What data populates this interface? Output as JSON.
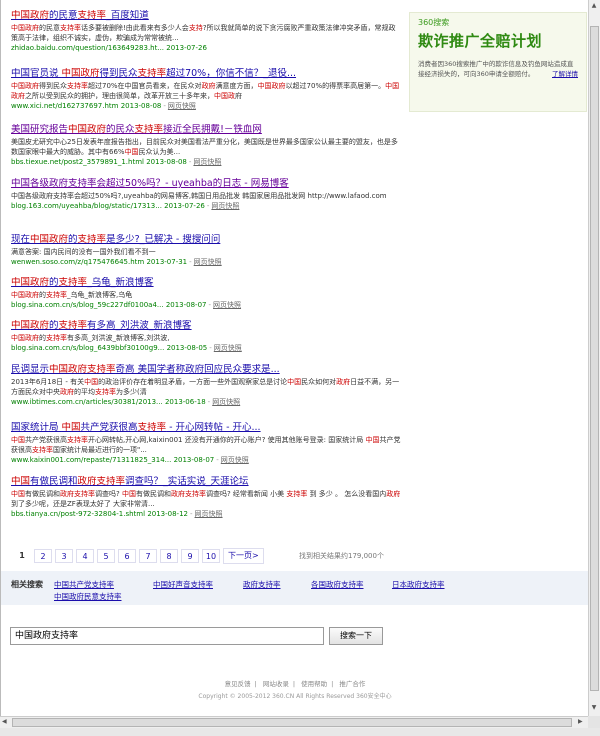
{
  "results": [
    {
      "title_parts": [
        {
          "t": "中国政府",
          "h": true
        },
        {
          "t": "的民意"
        },
        {
          "t": "支持率",
          "h": true
        },
        {
          "t": "_百度知道"
        }
      ],
      "snippet_parts": [
        {
          "t": "中国政府",
          "h": true
        },
        {
          "t": "的民意"
        },
        {
          "t": "支持率",
          "h": true
        },
        {
          "t": "话多要被删除!由此看来有多少人会"
        },
        {
          "t": "支持",
          "h": true
        },
        {
          "t": "?所以我就简单的说下贪污腐败严重政策法律冲突矛盾，常规政策高于法律，组织不诚实，虚伪，欺骗成为常常被统..."
        }
      ],
      "url": "zhidao.baidu.com/question/163649283.ht...",
      "date": "2013-07-26",
      "snapshot": ""
    },
    {
      "title_parts": [
        {
          "t": "中国官员说 "
        },
        {
          "t": "中国政府",
          "h": true
        },
        {
          "t": "得到民众"
        },
        {
          "t": "支持率",
          "h": true
        },
        {
          "t": "超过70%，你信不信？_退役..."
        }
      ],
      "snippet_parts": [
        {
          "t": "中国政府",
          "h": true
        },
        {
          "t": "得到民众"
        },
        {
          "t": "支持率",
          "h": true
        },
        {
          "t": "超过70%在中国官员看来，在民众对"
        },
        {
          "t": "政府",
          "h": true
        },
        {
          "t": "满意度方面，"
        },
        {
          "t": "中国政府",
          "h": true
        },
        {
          "t": "以超过70%的得票率高居第一。"
        },
        {
          "t": "中国政府",
          "h": true
        },
        {
          "t": "之所以受到民众的拥护，理由很简单，改革开放三十多年来，"
        },
        {
          "t": "中国政",
          "h": true
        },
        {
          "t": "府"
        }
      ],
      "url": "www.xici.net/d162737697.htm",
      "date": "2013-08-08",
      "snapshot": "网页快照"
    },
    {
      "visited": true,
      "title_parts": [
        {
          "t": "美国研究报告"
        },
        {
          "t": "中国政府",
          "h": true
        },
        {
          "t": "的民众"
        },
        {
          "t": "支持率",
          "h": true
        },
        {
          "t": "接近全民拥戴!－铁血网"
        }
      ],
      "snippet_parts": [
        {
          "t": "美国皮尤研究中心25日发表年度报告指出，目前民众对美国看法严重分化，美国既是世界最多国家公认最主要的盟友，也是多数国家眼中最大的威胁。其中有66%"
        },
        {
          "t": "中国",
          "h": true
        },
        {
          "t": "民众认为美..."
        }
      ],
      "url": "bbs.tiexue.net/post2_3579891_1.html",
      "date": "2013-08-08",
      "snapshot": "网页快照"
    },
    {
      "visited": true,
      "title_parts": [
        {
          "t": "中国各级政府支持率会超过50%吗？- uyeahba的日志 - 网易博客"
        }
      ],
      "snippet_parts": [
        {
          "t": "中国各级政府支持率会超过50%吗?,uyeahba的网易博客,韩国日用品批发 韩国家居用品批发网 http://www.lafaod.com"
        }
      ],
      "url": "blog.163.com/uyeahba/blog/static/17313...",
      "date": "2013-07-26",
      "snapshot": "网页快照"
    },
    {
      "title_parts": [
        {
          "t": "现在"
        },
        {
          "t": "中国政府",
          "h": true
        },
        {
          "t": "的"
        },
        {
          "t": "支持率",
          "h": true
        },
        {
          "t": "是多少?_已解决 - 搜搜问问"
        }
      ],
      "snippet_parts": [
        {
          "t": "满意答案: 国内民间的没有一国外我们看不到一"
        }
      ],
      "url": "wenwen.soso.com/z/q175476645.htm",
      "date": "2013-07-31",
      "snapshot": "网页快照"
    },
    {
      "title_parts": [
        {
          "t": "中国政府",
          "h": true
        },
        {
          "t": "的"
        },
        {
          "t": "支持率",
          "h": true
        },
        {
          "t": "_乌龟_新浪博客"
        }
      ],
      "snippet_parts": [
        {
          "t": "中国政府",
          "h": true
        },
        {
          "t": "的"
        },
        {
          "t": "支持率",
          "h": true
        },
        {
          "t": "_乌龟_新浪博客,乌龟"
        }
      ],
      "url": "blog.sina.com.cn/s/blog_59c227df0100a4...",
      "date": "2013-08-07",
      "snapshot": "网页快照"
    },
    {
      "title_parts": [
        {
          "t": "中国政府",
          "h": true
        },
        {
          "t": "的"
        },
        {
          "t": "支持率",
          "h": true
        },
        {
          "t": "有多高_刘洪波_新浪博客"
        }
      ],
      "snippet_parts": [
        {
          "t": "中国政府",
          "h": true
        },
        {
          "t": "的"
        },
        {
          "t": "支持率",
          "h": true
        },
        {
          "t": "有多高_刘洪波_新浪博客,刘洪波,"
        }
      ],
      "url": "blog.sina.com.cn/s/blog_6439bbf30100g9...",
      "date": "2013-08-05",
      "snapshot": "网页快照"
    },
    {
      "title_parts": [
        {
          "t": "民调显示"
        },
        {
          "t": "中国政府",
          "h": true
        },
        {
          "t": "支持率",
          "h": true
        },
        {
          "t": "奇高 美国学者称政府回应民众要求是..."
        }
      ],
      "snippet_parts": [
        {
          "t": "2013年6月18日 - 有关"
        },
        {
          "t": "中国",
          "h": true
        },
        {
          "t": "的政治评价存在着明显矛盾，一方面一些外国观察家总是讨论"
        },
        {
          "t": "中国",
          "h": true
        },
        {
          "t": "民众如何对"
        },
        {
          "t": "政府",
          "h": true
        },
        {
          "t": "日益不满，另一方面民众对中央"
        },
        {
          "t": "政府",
          "h": true
        },
        {
          "t": "的平均"
        },
        {
          "t": "支持率",
          "h": true
        },
        {
          "t": "为多少(清"
        }
      ],
      "url": "www.ibtimes.com.cn/articles/30381/2013...",
      "date": "2013-06-18",
      "snapshot": "网页快照"
    },
    {
      "title_parts": [
        {
          "t": "国家统计局 "
        },
        {
          "t": "中国",
          "h": true
        },
        {
          "t": "共产党获很高"
        },
        {
          "t": "支持率",
          "h": true
        },
        {
          "t": " - 开心网转帖 - 开心..."
        }
      ],
      "snippet_parts": [
        {
          "t": "中国",
          "h": true
        },
        {
          "t": "共产党获很高"
        },
        {
          "t": "支持率",
          "h": true
        },
        {
          "t": "开心网转帖,开心网,kaixin001 还没有开通你的开心账户? 使用其他账号登录: 国家统计局 "
        },
        {
          "t": "中国",
          "h": true
        },
        {
          "t": "共产党获很高"
        },
        {
          "t": "支持率",
          "h": true
        },
        {
          "t": "国家统计局最近进行的一项\"..."
        }
      ],
      "url": "www.kaixin001.com/repaste/71311825_314...",
      "date": "2013-08-07",
      "snapshot": "网页快照"
    },
    {
      "title_parts": [
        {
          "t": "中国",
          "h": true
        },
        {
          "t": "有做民调和"
        },
        {
          "t": "政府支持率",
          "h": true
        },
        {
          "t": "调查吗？_实话实说_天涯论坛"
        }
      ],
      "snippet_parts": [
        {
          "t": "中国",
          "h": true
        },
        {
          "t": "有做民调和"
        },
        {
          "t": "政府支持率",
          "h": true
        },
        {
          "t": "调查吗? "
        },
        {
          "t": "中国",
          "h": true
        },
        {
          "t": "有做民调和"
        },
        {
          "t": "政府支持率",
          "h": true
        },
        {
          "t": "调查吗? 经常看新闻 小美 "
        },
        {
          "t": "支持率",
          "h": true
        },
        {
          "t": " 到 多少 。 怎么没看国内"
        },
        {
          "t": "政府",
          "h": true
        },
        {
          "t": "到了多少呢，还是ZF表现太好了 大家非常清..."
        }
      ],
      "url": "bbs.tianya.cn/post-972-32804-1.shtml",
      "date": "2013-08-12",
      "snapshot": "网页快照"
    }
  ],
  "ad": {
    "brand": "360搜索",
    "headline": "欺诈推广全赔计划",
    "text": "消费者因360搜索推广中的欺诈信息及钓鱼网站造成直接经济损失的，可向360申请全额赔付。",
    "link": "了解详情"
  },
  "pagination": {
    "pages": [
      "1",
      "2",
      "3",
      "4",
      "5",
      "6",
      "7",
      "8",
      "9",
      "10"
    ],
    "current": "1",
    "next": "下一页>",
    "result_count": "找到相关结果约179,000个"
  },
  "related": {
    "label": "相关搜索",
    "links": [
      "中国共产党支持率",
      "中国好声音支持率",
      "政府支持率",
      "各国政府支持率",
      "日本政府支持率",
      "中国政府民意支持率"
    ]
  },
  "search": {
    "query": "中国政府支持率",
    "button": "搜索一下"
  },
  "footer": {
    "links": [
      "意见反馈",
      "网站收录",
      "使用帮助",
      "推广合作"
    ],
    "copyright": "Copyright © 2005-2012 360.CN All Rights Reserved 360安全中心"
  },
  "colors": {
    "link": "#1a0dab",
    "highlight": "#cc0000",
    "url": "#008000",
    "ad_green": "#2f8a12"
  }
}
